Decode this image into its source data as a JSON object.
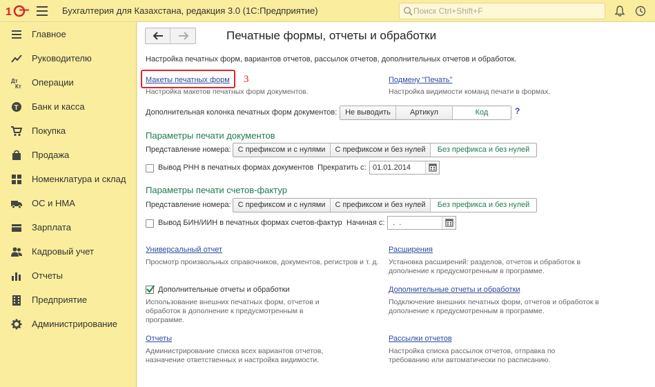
{
  "app": {
    "title": "Бухгалтерия для Казахстана, редакция 3.0  (1С:Предприятие)",
    "search_placeholder": "Поиск Ctrl+Shift+F"
  },
  "sidebar": {
    "items": [
      {
        "label": "Главное",
        "icon": "menu-lines-icon"
      },
      {
        "label": "Руководителю",
        "icon": "trend-chart-icon"
      },
      {
        "label": "Операции",
        "icon": "dt-kt-icon"
      },
      {
        "label": "Банк и касса",
        "icon": "coin-icon"
      },
      {
        "label": "Покупка",
        "icon": "cart-icon"
      },
      {
        "label": "Продажа",
        "icon": "bag-icon"
      },
      {
        "label": "Номенклатура и склад",
        "icon": "grid-icon"
      },
      {
        "label": "ОС и НМА",
        "icon": "truck-icon"
      },
      {
        "label": "Зарплата",
        "icon": "wallet-icon"
      },
      {
        "label": "Кадровый учет",
        "icon": "people-icon"
      },
      {
        "label": "Отчеты",
        "icon": "bar-chart-icon"
      },
      {
        "label": "Предприятие",
        "icon": "building-icon"
      },
      {
        "label": "Администрирование",
        "icon": "gear-icon"
      }
    ]
  },
  "main": {
    "title": "Печатные формы, отчеты и обработки",
    "description": "Настройка печатных форм, вариантов отчетов, рассылок отчетов, дополнительных отчетов и обработок.",
    "annotation": "3",
    "print_layouts": {
      "link": "Макеты печатных форм",
      "note": "Настройка макетов печатных форм документов."
    },
    "print_replace": {
      "link": "Подмену \"Печать\"",
      "note": "Настройка видимости команд печати в формах."
    },
    "extra_column": {
      "label": "Дополнительная колонка печатных форм документов:",
      "options": [
        "Не выводить",
        "Артикул",
        "Код"
      ],
      "selected": 2,
      "help": "?"
    },
    "doc_print": {
      "section": "Параметры печати документов",
      "number_label": "Представление номера:",
      "number_options": [
        "С префиксом и с нулями",
        "С префиксом и без нулей",
        "Без префикса и без нулей"
      ],
      "number_selected": 2,
      "rnn_checkbox": "Вывод РНН в печатных формах документов",
      "rnn_checked": false,
      "stop_label": "Прекратить с:",
      "stop_date": "01.01.2014"
    },
    "invoice_print": {
      "section": "Параметры печати счетов-фактур",
      "number_label": "Представление номера:",
      "number_options": [
        "С префиксом и с нулями",
        "С префиксом и без нулей",
        "Без префикса и без нулей"
      ],
      "number_selected": 2,
      "bin_checkbox": "Вывод БИН/ИИН в печатных формах счетов-фактур",
      "bin_checked": false,
      "start_label": "Начиная с:",
      "start_date": " .  ."
    },
    "universal_report": {
      "link": "Универсальный отчет",
      "note": "Просмотр произвольных справочников, документов, регистров и т. д."
    },
    "extensions": {
      "link": "Расширения",
      "note": "Установка расширений: разделов, отчетов и обработок в дополнение к предусмотренным в программе."
    },
    "addl_reports_check": {
      "label": "Дополнительные отчеты и обработки",
      "checked": true,
      "note": "Использование внешних печатных форм, отчетов и обработок в дополнение к предусмотренным в программе."
    },
    "addl_reports_link": {
      "link": "Дополнительные отчеты и обработки",
      "note": "Подключение внешних печатных форм, отчетов и обработок в дополнение к предусмотренным в программе."
    },
    "reports": {
      "link": "Отчеты",
      "note": "Администрирование списка всех вариантов отчетов, назначение ответственных и настройка видимости."
    },
    "mailings": {
      "link": "Рассылки отчетов",
      "note": "Настройка списка рассылок отчетов, отправка по требованию или автоматически по расписанию."
    }
  },
  "colors": {
    "accent_yellow": "#fbed9e",
    "section_green": "#1f7a52",
    "link_blue": "#2a4ba0",
    "annotation_red": "#e0242a"
  }
}
